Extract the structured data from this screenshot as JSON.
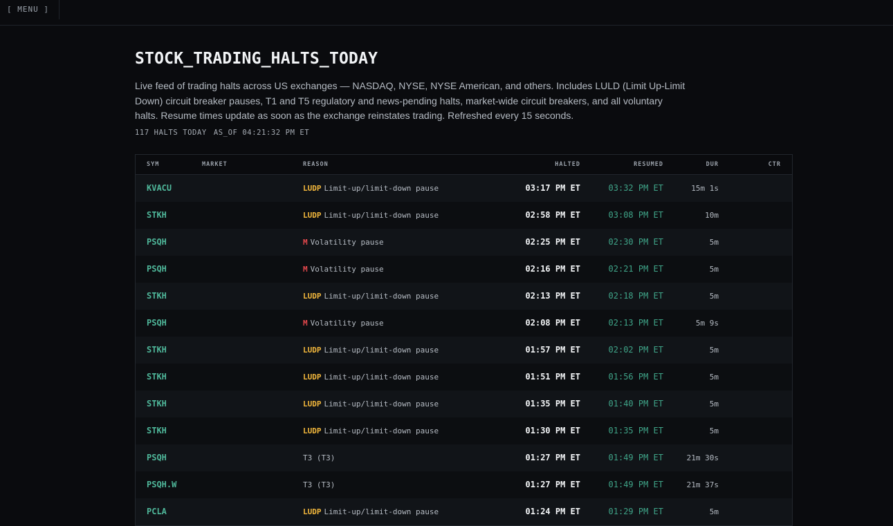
{
  "menu": {
    "label": "[ MENU ]"
  },
  "page": {
    "title": "STOCK_TRADING_HALTS_TODAY",
    "description": "Live feed of trading halts across US exchanges — NASDAQ, NYSE, NYSE American, and others. Includes LULD (Limit Up-Limit Down) circuit breaker pauses, T1 and T5 regulatory and news-pending halts, market-wide circuit breakers, and all voluntary halts. Resume times update as soon as the exchange reinstates trading. Refreshed every 15 seconds.",
    "count": "117 HALTS TODAY",
    "as_of": "AS_OF 04:21:32 PM ET"
  },
  "colors": {
    "ludp": "#f2b73c",
    "m": "#e5484d",
    "sym": "#4fb79a",
    "resumed": "#3fa488"
  },
  "table": {
    "headers": {
      "sym": "SYM",
      "market": "MARKET",
      "reason": "REASON",
      "halted": "HALTED",
      "resumed": "RESUMED",
      "dur": "DUR",
      "ctr": "CTR"
    },
    "rows": [
      {
        "sym": "KVACU",
        "market": "",
        "code": "LUDP",
        "reason": "Limit-up/limit-down pause",
        "halted": "03:17 PM ET",
        "resumed": "03:32 PM ET",
        "dur": "15m 1s",
        "ctr": ""
      },
      {
        "sym": "STKH",
        "market": "",
        "code": "LUDP",
        "reason": "Limit-up/limit-down pause",
        "halted": "02:58 PM ET",
        "resumed": "03:08 PM ET",
        "dur": "10m",
        "ctr": ""
      },
      {
        "sym": "PSQH",
        "market": "",
        "code": "M",
        "reason": "Volatility pause",
        "halted": "02:25 PM ET",
        "resumed": "02:30 PM ET",
        "dur": "5m",
        "ctr": ""
      },
      {
        "sym": "PSQH",
        "market": "",
        "code": "M",
        "reason": "Volatility pause",
        "halted": "02:16 PM ET",
        "resumed": "02:21 PM ET",
        "dur": "5m",
        "ctr": ""
      },
      {
        "sym": "STKH",
        "market": "",
        "code": "LUDP",
        "reason": "Limit-up/limit-down pause",
        "halted": "02:13 PM ET",
        "resumed": "02:18 PM ET",
        "dur": "5m",
        "ctr": ""
      },
      {
        "sym": "PSQH",
        "market": "",
        "code": "M",
        "reason": "Volatility pause",
        "halted": "02:08 PM ET",
        "resumed": "02:13 PM ET",
        "dur": "5m 9s",
        "ctr": ""
      },
      {
        "sym": "STKH",
        "market": "",
        "code": "LUDP",
        "reason": "Limit-up/limit-down pause",
        "halted": "01:57 PM ET",
        "resumed": "02:02 PM ET",
        "dur": "5m",
        "ctr": ""
      },
      {
        "sym": "STKH",
        "market": "",
        "code": "LUDP",
        "reason": "Limit-up/limit-down pause",
        "halted": "01:51 PM ET",
        "resumed": "01:56 PM ET",
        "dur": "5m",
        "ctr": ""
      },
      {
        "sym": "STKH",
        "market": "",
        "code": "LUDP",
        "reason": "Limit-up/limit-down pause",
        "halted": "01:35 PM ET",
        "resumed": "01:40 PM ET",
        "dur": "5m",
        "ctr": ""
      },
      {
        "sym": "STKH",
        "market": "",
        "code": "LUDP",
        "reason": "Limit-up/limit-down pause",
        "halted": "01:30 PM ET",
        "resumed": "01:35 PM ET",
        "dur": "5m",
        "ctr": ""
      },
      {
        "sym": "PSQH",
        "market": "",
        "code": "",
        "reason": "T3 (T3)",
        "halted": "01:27 PM ET",
        "resumed": "01:49 PM ET",
        "dur": "21m 30s",
        "ctr": ""
      },
      {
        "sym": "PSQH.W",
        "market": "",
        "code": "",
        "reason": "T3 (T3)",
        "halted": "01:27 PM ET",
        "resumed": "01:49 PM ET",
        "dur": "21m 37s",
        "ctr": ""
      },
      {
        "sym": "PCLA",
        "market": "",
        "code": "LUDP",
        "reason": "Limit-up/limit-down pause",
        "halted": "01:24 PM ET",
        "resumed": "01:29 PM ET",
        "dur": "5m",
        "ctr": ""
      }
    ]
  }
}
